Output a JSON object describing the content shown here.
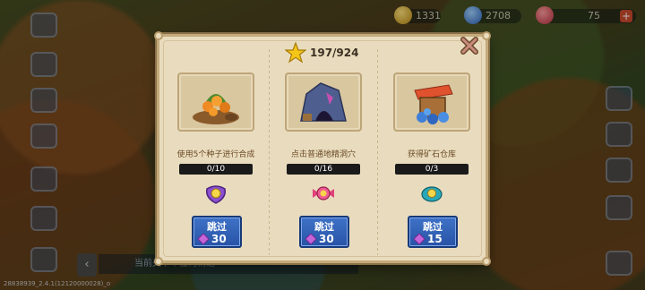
{
  "resources": {
    "gold": "1331",
    "gems": "2708",
    "energy": "75"
  },
  "bottom_bar": {
    "text": "当前关卡中任何精通"
  },
  "version": "28838939_2.4.1(12120000028)_o",
  "panel": {
    "progress": "197/924",
    "star_icon": "star-icon",
    "close_icon": "close-icon",
    "tasks": [
      {
        "description": "使用5个种子进行合成",
        "count": "0/10",
        "progress_fraction": 0,
        "image": "berry-bush-image",
        "reward_icon": "purple-gem-pouch-icon",
        "skip_label": "跳过",
        "skip_cost": "30"
      },
      {
        "description": "点击普通地精洞穴",
        "count": "0/16",
        "progress_fraction": 0,
        "image": "goblin-cave-image",
        "reward_icon": "pink-candy-icon",
        "skip_label": "跳过",
        "skip_cost": "30"
      },
      {
        "description": "获得矿石仓库",
        "count": "0/3",
        "progress_fraction": 0,
        "image": "ore-warehouse-image",
        "reward_icon": "teal-coin-icon",
        "skip_label": "跳过",
        "skip_cost": "15"
      }
    ]
  },
  "colors": {
    "panel_bg": "#e9dcbe",
    "skip_button": "#3e72c7",
    "progress_fill": "#5ec443",
    "gem": "#c565d8"
  }
}
